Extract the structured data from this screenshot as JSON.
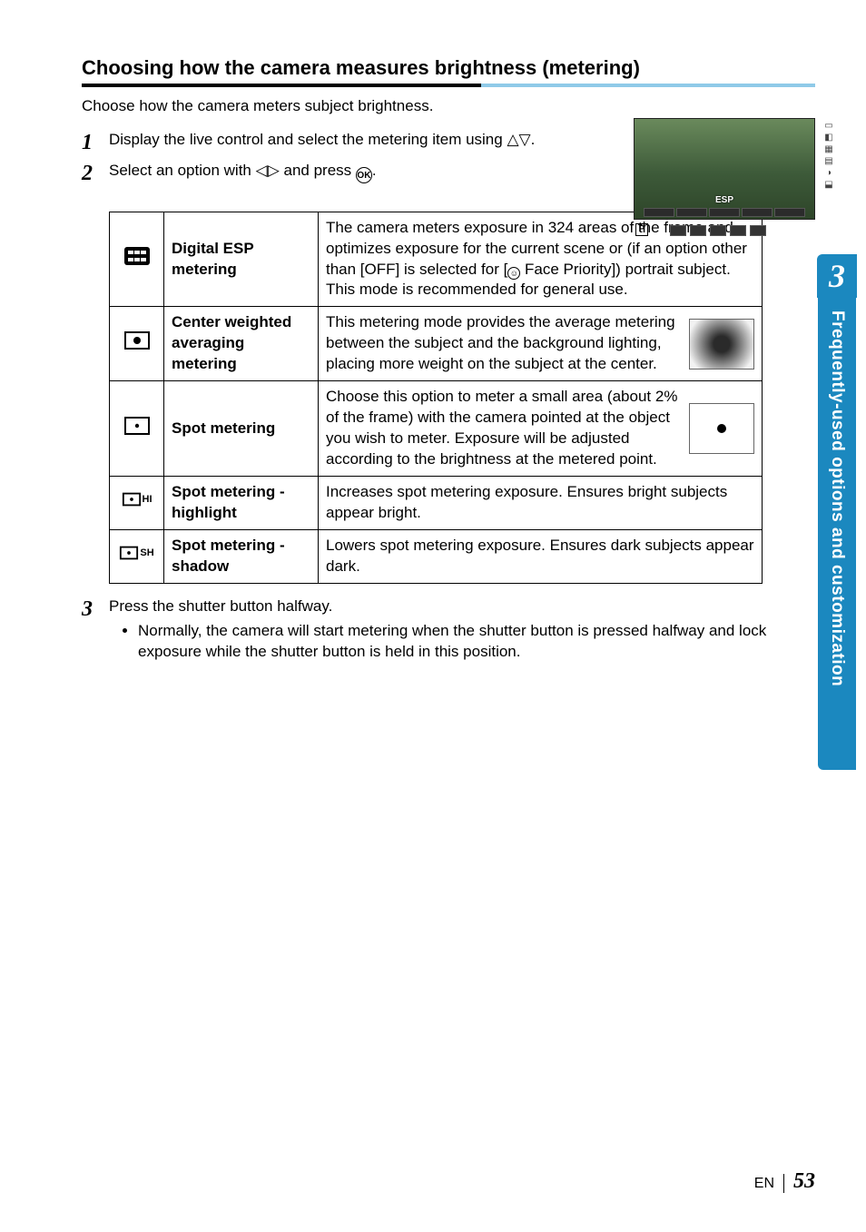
{
  "heading": "Choosing how the camera measures brightness (metering)",
  "intro": "Choose how the camera meters subject brightness.",
  "steps": {
    "s1": "Display the live control and select the metering item using",
    "s1_suffix": ".",
    "s2_a": "Select an option with",
    "s2_b": "and press",
    "s2_c": ".",
    "s3": "Press the shutter button halfway.",
    "s3_bullet": "Normally, the camera will start metering when the shutter button is pressed halfway and lock exposure while the shutter button is held in this position."
  },
  "lcd": {
    "label": "ESP",
    "mode": "P"
  },
  "table": {
    "rows": [
      {
        "icon": "esp",
        "name": "Digital ESP metering",
        "desc_before": "The camera meters exposure in 324 areas of the frame and optimizes exposure for the current scene or (if an option other than [OFF] is selected for [",
        "desc_face_label": " Face Priority])",
        "desc_after": " portrait subject. This mode is recommended for general use.",
        "swatch": "none"
      },
      {
        "icon": "center",
        "name": "Center weighted averaging metering",
        "desc": "This metering mode provides the average metering between the subject and the background lighting, placing more weight on the subject at the center.",
        "swatch": "grad"
      },
      {
        "icon": "spot",
        "name": "Spot metering",
        "desc": "Choose this option to meter a small area (about 2% of the frame) with the camera pointed at the object you wish to meter. Exposure will be adjusted according to the brightness at the metered point.",
        "swatch": "dot"
      },
      {
        "icon": "spot-hi",
        "icon_suffix": "HI",
        "name": "Spot metering - highlight",
        "desc": "Increases spot metering exposure. Ensures bright subjects appear bright.",
        "swatch": "none"
      },
      {
        "icon": "spot-sh",
        "icon_suffix": "SH",
        "name": "Spot metering - shadow",
        "desc": "Lowers spot metering exposure. Ensures dark subjects appear dark.",
        "swatch": "none"
      }
    ]
  },
  "sidebar": {
    "chapter": "3",
    "label": "Frequently-used options and customization"
  },
  "footer": {
    "lang": "EN",
    "page": "53"
  }
}
